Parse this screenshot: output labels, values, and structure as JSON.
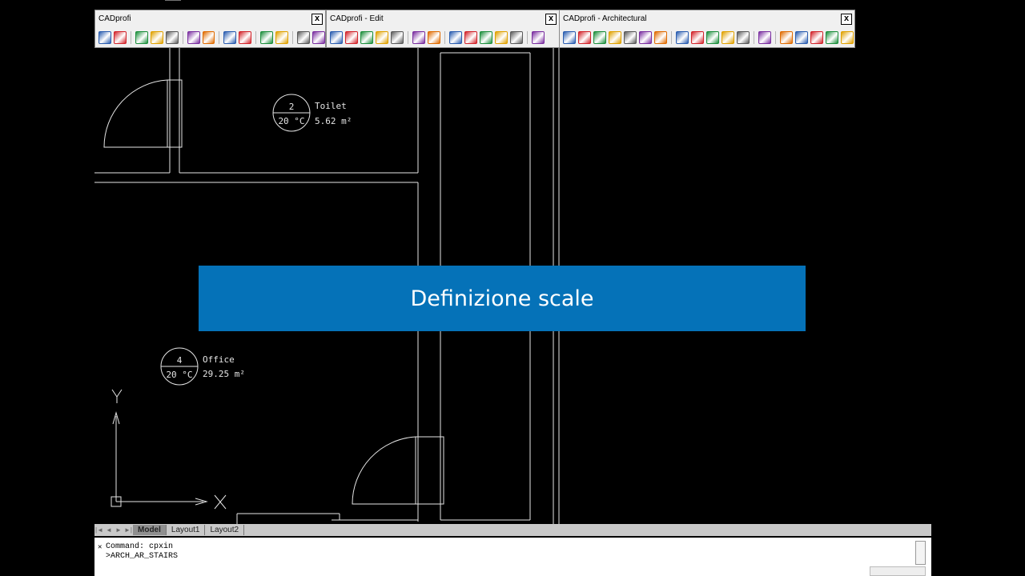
{
  "toolbars": [
    {
      "title": "CADprofi",
      "close": "x"
    },
    {
      "title": "CADprofi - Edit",
      "close": "x"
    },
    {
      "title": "CADprofi - Architectural",
      "close": "x"
    }
  ],
  "drawing": {
    "room1": {
      "number": "2",
      "name": "Toilet",
      "temperature": "20 °C",
      "area": "5.62 m²"
    },
    "room2": {
      "number": "4",
      "name": "Office",
      "temperature": "20 °C",
      "area": "29.25 m²"
    },
    "ucs": {
      "x_label": "X",
      "y_label": "Y"
    }
  },
  "banner": {
    "text": "Definizione scale"
  },
  "layout_tabs": [
    "Model",
    "Layout1",
    "Layout2"
  ],
  "command_line": {
    "history": "Command: cpxin",
    "current": ">ARCH_AR_STAIRS"
  },
  "icons": {
    "toolbar1": [
      "new-icon",
      "copy-icon",
      "layers-icon",
      "text-icon",
      "info-icon",
      "block-icon",
      "symbol-icon",
      "table-icon",
      "diamond-icon",
      "line-icon",
      "settings-icon",
      "door-icon",
      "help-icon"
    ],
    "toolbar2": [
      "edit-icon",
      "edit-icon",
      "edit-icon",
      "edit-icon",
      "edit-icon",
      "edit-icon",
      "edit-icon",
      "pipe-icon",
      "pipe-icon",
      "fitting-icon",
      "pipe-icon",
      "pipe-icon",
      "measure-icon"
    ],
    "toolbar3": [
      "wall-icon",
      "hatch-icon",
      "window-icon",
      "stairs-icon",
      "brick-icon",
      "furniture-icon",
      "door-icon",
      "compass-icon",
      "table-icon",
      "level-icon",
      "arrow-icon",
      "target-icon",
      "info-icon",
      "arrow-right-icon",
      "dimension-icon",
      "dimension-icon",
      "dimension-icon",
      "dimension-icon"
    ]
  },
  "colors": {
    "banner": "#0572b8",
    "background": "#000000"
  }
}
